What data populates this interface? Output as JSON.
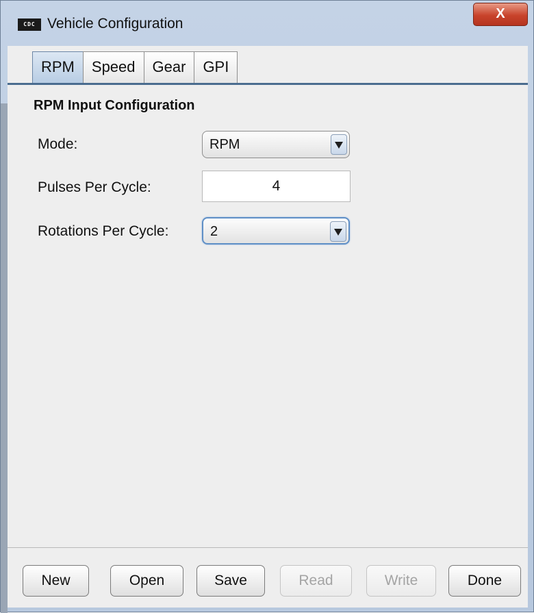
{
  "window": {
    "title": "Vehicle Configuration",
    "icon_text": "CDC",
    "close_label": "X"
  },
  "tabs": [
    {
      "label": "RPM",
      "active": true
    },
    {
      "label": "Speed",
      "active": false
    },
    {
      "label": "Gear",
      "active": false
    },
    {
      "label": "GPI",
      "active": false
    }
  ],
  "section": {
    "title": "RPM Input Configuration"
  },
  "fields": {
    "mode": {
      "label": "Mode:",
      "value": "RPM"
    },
    "pulses": {
      "label": "Pulses Per Cycle:",
      "value": "4"
    },
    "rotations": {
      "label": "Rotations Per Cycle:",
      "value": "2"
    }
  },
  "buttons": [
    {
      "label": "New",
      "enabled": true
    },
    {
      "label": "Open",
      "enabled": true
    },
    {
      "label": "Save",
      "enabled": true
    },
    {
      "label": "Read",
      "enabled": false
    },
    {
      "label": "Write",
      "enabled": false
    },
    {
      "label": "Done",
      "enabled": true
    }
  ]
}
